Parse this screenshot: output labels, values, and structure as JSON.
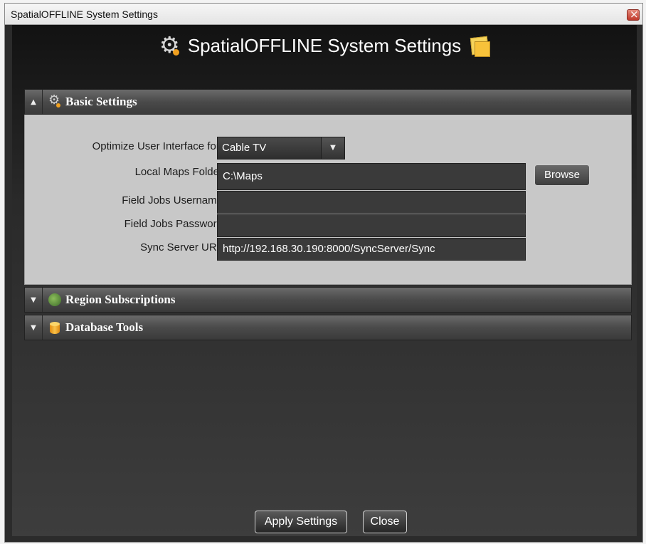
{
  "window": {
    "title": "SpatialOFFLINE System Settings"
  },
  "header": {
    "title": "SpatialOFFLINE System Settings"
  },
  "panels": {
    "basic": {
      "label": "Basic Settings",
      "fields": {
        "optimize_label": "Optimize User Interface for:",
        "optimize_value": "Cable TV",
        "maps_label": "Local Maps Folder",
        "maps_value": "C:\\Maps",
        "browse_label": "Browse",
        "username_label": "Field Jobs Username",
        "username_value": "",
        "password_label": "Field Jobs Password",
        "password_value": "",
        "sync_label": "Sync Server URL",
        "sync_value": "http://192.168.30.190:8000/SyncServer/Sync"
      }
    },
    "region": {
      "label": "Region Subscriptions"
    },
    "database": {
      "label": "Database Tools"
    }
  },
  "footer": {
    "apply_label": "Apply Settings",
    "close_label": "Close"
  },
  "icons": {
    "title_left": "gear-icon",
    "title_right": "sticky-notes-icon",
    "basic": "gear-icon",
    "region": "globe-icon",
    "database": "database-icon"
  },
  "colors": {
    "accent": "#f0a020",
    "panel_body": "#c8c8c8",
    "window_bg": "#2b2b2b"
  }
}
